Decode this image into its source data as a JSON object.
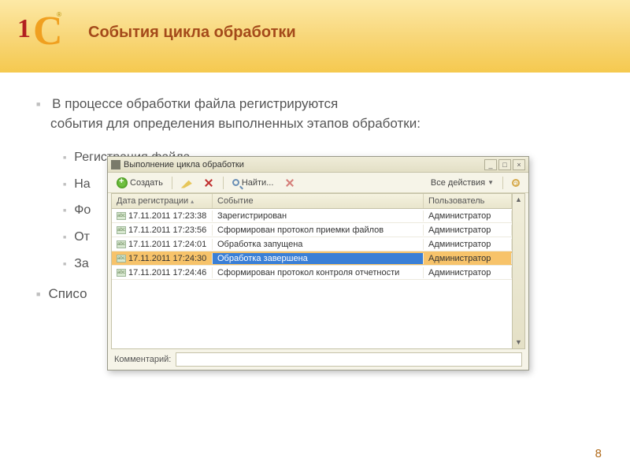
{
  "slide": {
    "title": "События цикла обработки",
    "page_number": "8"
  },
  "bullets": {
    "intro_line1": "В процессе обработки файла регистрируются",
    "intro_line2": "события для определения выполненных этапов обработки:",
    "sub": [
      "Регистрация файла",
      "На",
      "Фо",
      "От",
      "За"
    ],
    "list2": "Списо"
  },
  "dialog": {
    "title": "Выполнение цикла обработки",
    "toolbar": {
      "create": "Создать",
      "find": "Найти...",
      "all_actions": "Все действия"
    },
    "columns": {
      "date": "Дата регистрации",
      "event": "Событие",
      "user": "Пользователь"
    },
    "rows": [
      {
        "date": "17.11.2011 17:23:38",
        "event": "Зарегистрирован",
        "user": "Администратор"
      },
      {
        "date": "17.11.2011 17:23:56",
        "event": "Сформирован протокол приемки файлов",
        "user": "Администратор"
      },
      {
        "date": "17.11.2011 17:24:01",
        "event": "Обработка запущена",
        "user": "Администратор"
      },
      {
        "date": "17.11.2011 17:24:30",
        "event": "Обработка завершена",
        "user": "Администратор"
      },
      {
        "date": "17.11.2011 17:24:46",
        "event": "Сформирован протокол контроля отчетности",
        "user": "Администратор"
      }
    ],
    "comment_label": "Комментарий:"
  }
}
